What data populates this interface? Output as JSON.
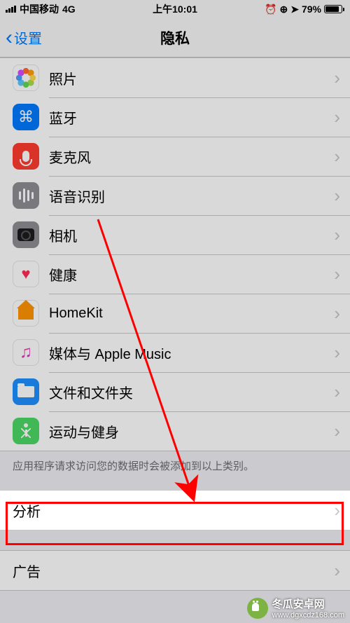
{
  "statusBar": {
    "carrier": "中国移动",
    "network": "4G",
    "time": "上午10:01",
    "battery": "79%"
  },
  "nav": {
    "back": "设置",
    "title": "隐私"
  },
  "rows": [
    {
      "id": "photos",
      "label": "照片"
    },
    {
      "id": "bluetooth",
      "label": "蓝牙"
    },
    {
      "id": "microphone",
      "label": "麦克风"
    },
    {
      "id": "speech",
      "label": "语音识别"
    },
    {
      "id": "camera",
      "label": "相机"
    },
    {
      "id": "health",
      "label": "健康"
    },
    {
      "id": "homekit",
      "label": "HomeKit"
    },
    {
      "id": "media",
      "label": "媒体与 Apple Music"
    },
    {
      "id": "files",
      "label": "文件和文件夹"
    },
    {
      "id": "activity",
      "label": "运动与健身"
    }
  ],
  "footer1": "应用程序请求访问您的数据时会被添加到以上类别。",
  "rows2": [
    {
      "id": "analytics",
      "label": "分析"
    }
  ],
  "rows3": [
    {
      "id": "ads",
      "label": "广告"
    }
  ],
  "watermark": {
    "title": "冬瓜安卓网",
    "url": "www.dgxcdz168.com"
  }
}
